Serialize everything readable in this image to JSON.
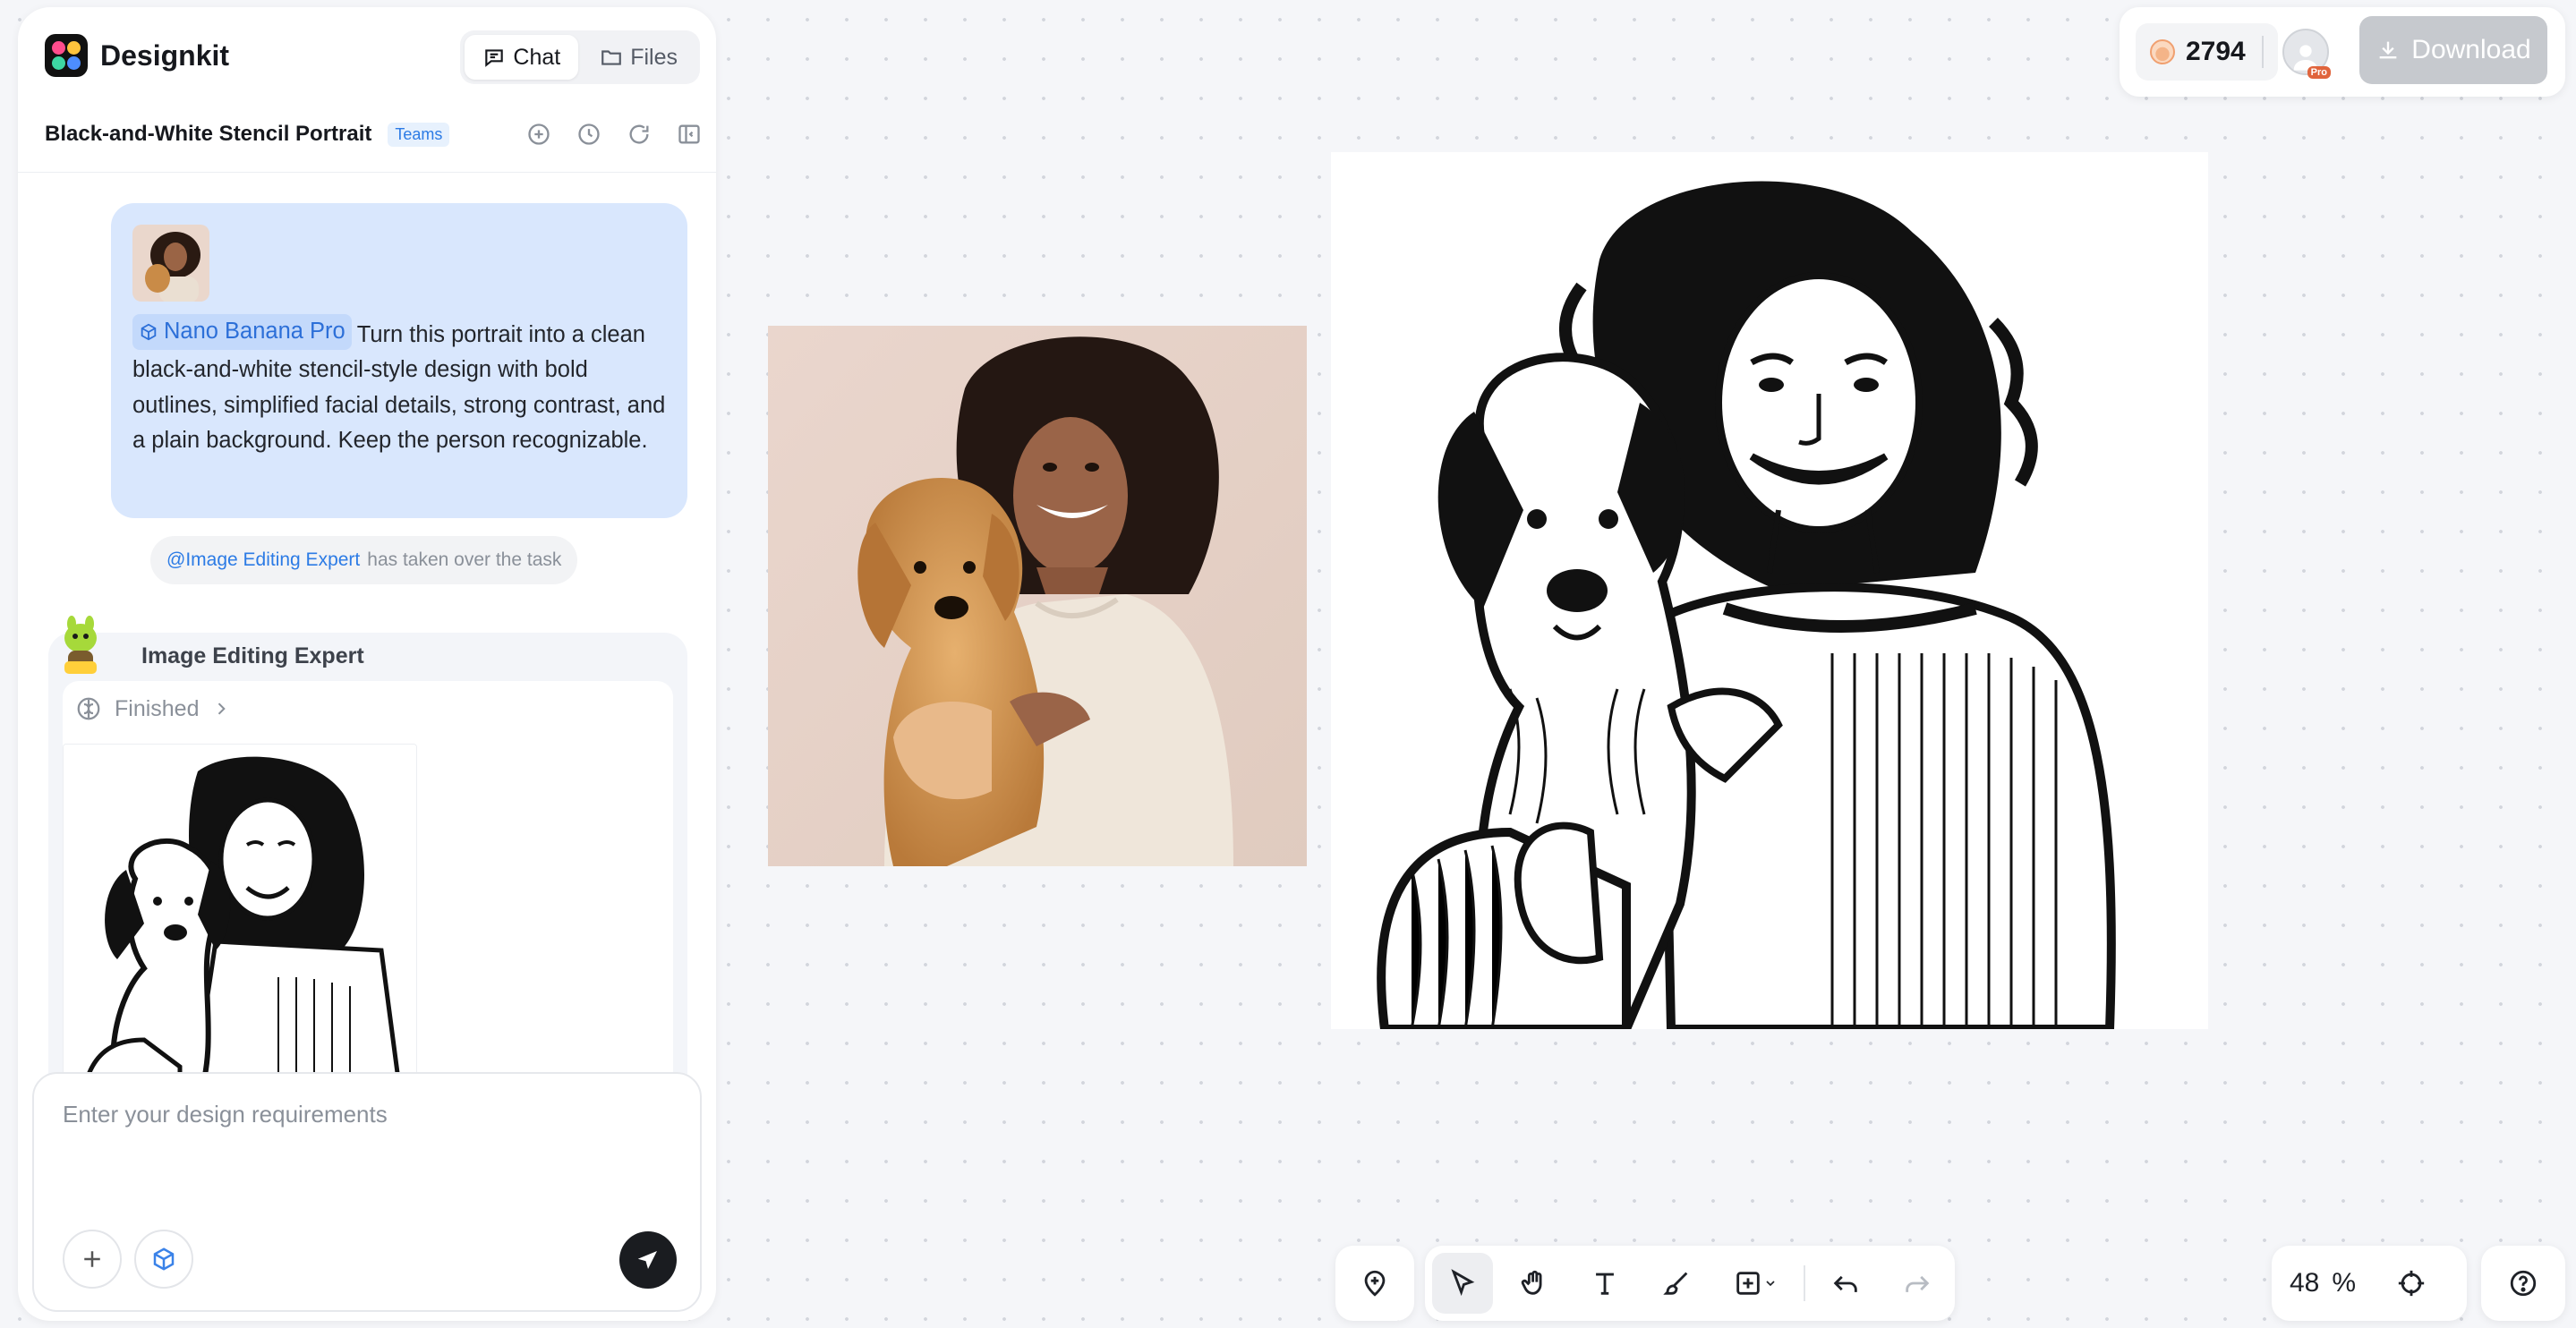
{
  "app": {
    "name": "Designkit"
  },
  "mode_tabs": [
    {
      "label": "Chat",
      "active": true
    },
    {
      "label": "Files",
      "active": false
    }
  ],
  "project": {
    "title": "Black-and-White Stencil Portrait",
    "badge": "Teams"
  },
  "chat": {
    "user_message": {
      "model_chip": "Nano Banana Pro",
      "text": "Turn this portrait into a clean black-and-white stencil-style design with bold outlines, simplified facial details, strong contrast, and a plain background. Keep the person recognizable."
    },
    "system_note": {
      "mention": "@Image Editing Expert",
      "text": "has taken over the task"
    },
    "agent": {
      "name": "Image Editing Expert",
      "status": "Finished"
    }
  },
  "composer": {
    "placeholder": "Enter your design requirements"
  },
  "topbar": {
    "credits": "2794",
    "pro_badge": "Pro",
    "download_label": "Download"
  },
  "zoom": {
    "value": "48",
    "unit": "%"
  },
  "colors": {
    "accent": "#2c7be5",
    "bubble": "#d9e7fd",
    "download_disabled": "#c6c9ce",
    "send": "#1a1c20"
  }
}
